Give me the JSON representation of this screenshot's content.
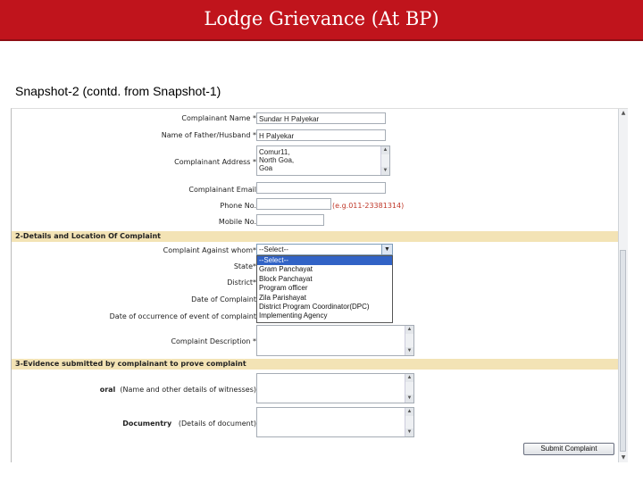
{
  "slide": {
    "title": "Lodge Grievance (At BP)",
    "subtitle": "Snapshot-2 (contd. from Snapshot-1)"
  },
  "form": {
    "complainant_name_label": "Complainant Name *",
    "complainant_name_value": "Sundar H Palyekar",
    "father_name_label": "Name of Father/Husband *",
    "father_name_value": "H Palyekar",
    "address_label": "Complainant Address *",
    "address_lines": [
      "Comur11,",
      "North Goa,",
      "Goa"
    ],
    "email_label": "Complainant Email",
    "email_value": "",
    "phone_label": "Phone No.",
    "phone_value": "",
    "phone_hint": "(e.g.011-23381314)",
    "mobile_label": "Mobile No.",
    "mobile_value": "",
    "section2_title": "2-Details and Location Of Complaint",
    "against_label": "Complaint Against whom*",
    "against_value": "--Select--",
    "against_options": [
      "--Select--",
      "Gram Panchayat",
      "Block Panchayat",
      "Program officer",
      "Zila Parishayat",
      "District Program Coordinator(DPC)",
      "Implementing Agency"
    ],
    "against_selected_index": 0,
    "state_label": "State*",
    "district_label": "District*",
    "date_label": "Date of Complaint",
    "occurrence_label": "Date of occurrence of event of complaint",
    "description_label": "Complaint Description *",
    "section3_title": "3-Evidence submitted by complainant to prove complaint",
    "oral_label": "oral",
    "oral_note": "(Name and other details of witnesses)",
    "doc_label": "Documentry",
    "doc_note": "(Details of document)",
    "submit_label": "Submit Complaint"
  },
  "icons": {
    "scroll_up": "scroll-up-icon",
    "scroll_down": "scroll-down-icon",
    "dropdown_arrow": "chevron-down-icon"
  },
  "colors": {
    "title_bar": "#c0141c",
    "section_bg": "#f3e3b5",
    "selection": "#3163c6",
    "hint": "#c0392b"
  }
}
